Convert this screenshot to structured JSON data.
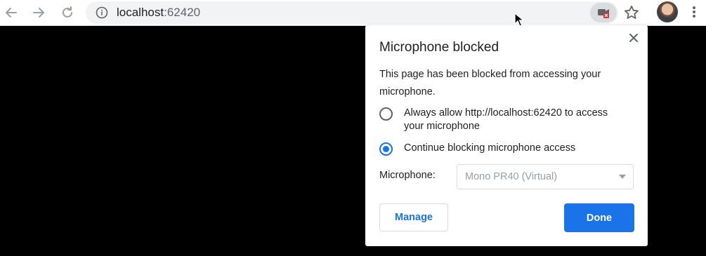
{
  "toolbar": {
    "back_icon": "arrow-left-icon",
    "forward_icon": "arrow-right-icon",
    "reload_icon": "reload-icon",
    "url_host": "localhost",
    "url_port": ":62420",
    "site_info_icon": "info-icon",
    "camera_blocked_icon": "camera-blocked-icon",
    "bookmark_icon": "star-icon",
    "menu_icon": "kebab-menu-icon"
  },
  "popup": {
    "title": "Microphone blocked",
    "description": "This page has been blocked from accessing your microphone.",
    "options": [
      {
        "label": "Always allow http://localhost:62420 to access your microphone",
        "selected": false
      },
      {
        "label": "Continue blocking microphone access",
        "selected": true
      }
    ],
    "microphone_label": "Microphone:",
    "microphone_selected": "Mono PR40 (Virtual)",
    "manage_label": "Manage",
    "done_label": "Done"
  },
  "colors": {
    "accent": "#1a73e8",
    "page_background": "#000000",
    "blocked_badge": "#d93025"
  }
}
